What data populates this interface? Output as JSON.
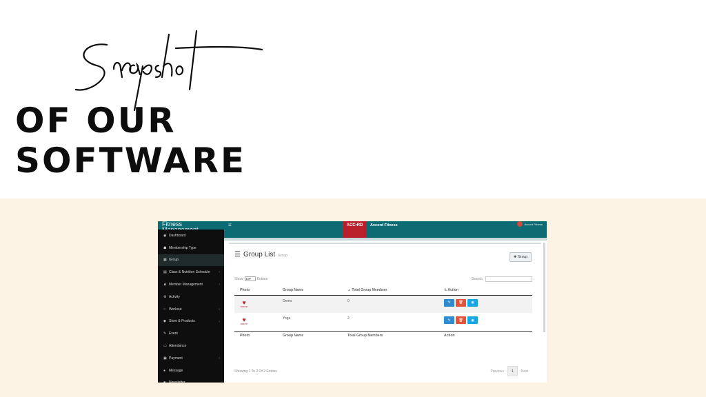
{
  "slide": {
    "script_word": "Snapshot",
    "heading_line1": "OF OUR",
    "heading_line2": "SOFTWARE",
    "colors": {
      "bottom_bg": "#fcf3e4",
      "heading": "#0d0d0d"
    }
  },
  "app": {
    "brand": "Fitness Management",
    "menu_icon": "hamburger-icon",
    "logo_text": "ACC•RD",
    "org_name": "Accord Fitness",
    "user_label": "Accord Fitness",
    "colors": {
      "topbar": "#0d6b73",
      "sidebar": "#0e0e0e",
      "edit": "#2f8ad0",
      "delete": "#e3543b",
      "view": "#17a8e3"
    }
  },
  "sidebar": {
    "items": [
      {
        "icon": "dashboard-icon",
        "glyph": "◉",
        "label": "Dashboard",
        "chevron": ""
      },
      {
        "icon": "users-icon",
        "glyph": "☗",
        "label": "Membership Type",
        "chevron": ""
      },
      {
        "icon": "group-icon",
        "glyph": "▦",
        "label": "Group",
        "chevron": "",
        "active": true
      },
      {
        "icon": "calendar-icon",
        "glyph": "▤",
        "label": "Class & Nutrition Schedule",
        "chevron": "‹"
      },
      {
        "icon": "user-icon",
        "glyph": "♟",
        "label": "Member Management",
        "chevron": "‹"
      },
      {
        "icon": "activity-icon",
        "glyph": "⚙",
        "label": "Activity",
        "chevron": ""
      },
      {
        "icon": "workout-icon",
        "glyph": "○",
        "label": "Workout",
        "chevron": "‹"
      },
      {
        "icon": "tag-icon",
        "glyph": "◆",
        "label": "Store & Products",
        "chevron": "‹"
      },
      {
        "icon": "pin-icon",
        "glyph": "✎",
        "label": "Event",
        "chevron": ""
      },
      {
        "icon": "attendance-icon",
        "glyph": "▭",
        "label": "Attendance",
        "chevron": ""
      },
      {
        "icon": "payment-icon",
        "glyph": "▣",
        "label": "Payment",
        "chevron": "‹"
      },
      {
        "icon": "message-icon",
        "glyph": "●",
        "label": "Message",
        "chevron": ""
      },
      {
        "icon": "newsletter-icon",
        "glyph": "■",
        "label": "Newsletter",
        "chevron": ""
      }
    ]
  },
  "page": {
    "title": "Group List",
    "subtitle": "Group",
    "add_button": "Group",
    "show_label": "Show",
    "show_value": "10",
    "entries_label": "Entries",
    "search_label": "Search:",
    "columns": [
      "Photo",
      "Group Name",
      "Total Group Members",
      "Action"
    ],
    "rows": [
      {
        "photo_caption": "TRIBUNIT",
        "name": "Demo",
        "members": "0"
      },
      {
        "photo_caption": "TRIBUNIT",
        "name": "Yoga",
        "members": "2"
      }
    ],
    "info": "Showing 1 To 2 Of 2 Entries",
    "pager": {
      "previous": "Previous",
      "current": "1",
      "next": "Next"
    }
  }
}
